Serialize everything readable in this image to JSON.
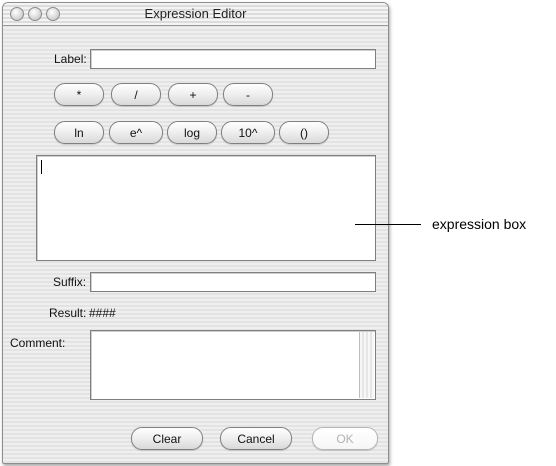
{
  "window": {
    "title": "Expression Editor"
  },
  "label_row": {
    "label": "Label:",
    "value": ""
  },
  "operators": [
    "*",
    "/",
    "+",
    "-"
  ],
  "functions": [
    "ln",
    "e^",
    "log",
    "10^",
    "()"
  ],
  "expression": {
    "value": ""
  },
  "suffix_row": {
    "label": "Suffix:",
    "value": ""
  },
  "result_row": {
    "label": "Result:",
    "value": "####"
  },
  "comment_row": {
    "label": "Comment:",
    "value": ""
  },
  "buttons": {
    "clear": "Clear",
    "cancel": "Cancel",
    "ok": "OK"
  },
  "annotation": {
    "text": "expression box"
  }
}
